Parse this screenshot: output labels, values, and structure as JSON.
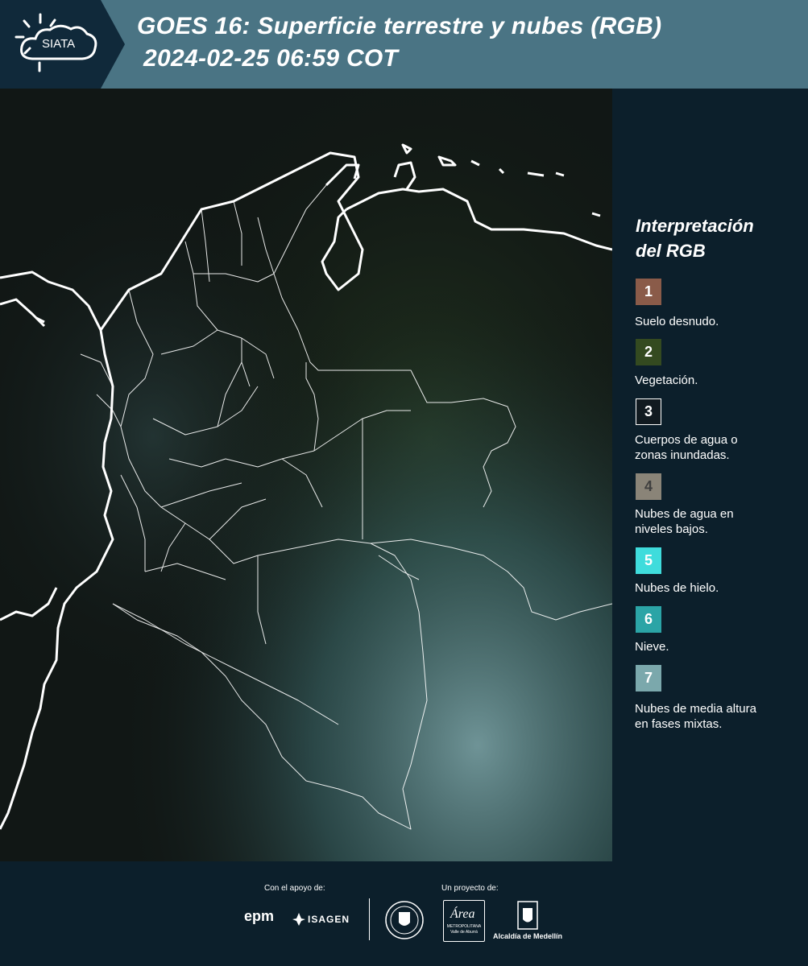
{
  "header": {
    "logo_text": "SIATA",
    "title_line1": "GOES 16: Superficie terrestre y nubes (RGB)",
    "title_line2": "2024-02-25 06:59 COT"
  },
  "legend": {
    "title_line1": "Interpretación",
    "title_line2": "del RGB",
    "items": [
      {
        "number": "1",
        "color": "#8a5b49",
        "label_line1": "Suelo desnudo.",
        "label_line2": ""
      },
      {
        "number": "2",
        "color": "#344a20",
        "label_line1": "Vegetación.",
        "label_line2": ""
      },
      {
        "number": "3",
        "color": "#111a20",
        "label_line1": "Cuerpos de agua o",
        "label_line2": "zonas inundadas."
      },
      {
        "number": "4",
        "color": "#8a8478",
        "label_line1": "Nubes de agua en",
        "label_line2": "niveles bajos."
      },
      {
        "number": "5",
        "color": "#3fdcdc",
        "label_line1": "Nubes de hielo.",
        "label_line2": ""
      },
      {
        "number": "6",
        "color": "#2ba4a6",
        "label_line1": "Nieve.",
        "label_line2": ""
      },
      {
        "number": "7",
        "color": "#7ba8ac",
        "label_line1": "Nubes de media altura",
        "label_line2": "en fases mixtas."
      }
    ]
  },
  "footer": {
    "support_caption": "Con el apoyo de:",
    "project_caption": "Un proyecto de:",
    "sponsor_epm": "epm",
    "sponsor_isagen": "ISAGEN",
    "area_metropolitana": "Área",
    "area_caption": "METROPOLITANA Valle de Aburrá",
    "alcaldia": "Alcaldía de Medellín"
  },
  "colors": {
    "header_bg": "#4a7484",
    "panel_bg": "#0c1f2b",
    "border_line": "#ffffff"
  }
}
